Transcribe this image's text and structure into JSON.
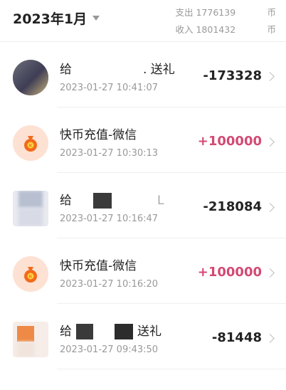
{
  "header": {
    "month": "2023年1月",
    "expense_label": "支出",
    "expense_value": "1776139",
    "income_label": "收入",
    "income_value": "1801432",
    "currency": "币"
  },
  "transactions": [
    {
      "title_prefix": "给",
      "title_suffix": ". 送礼",
      "time": "2023-01-27 10:41:07",
      "amount": "-173328",
      "type": "gift"
    },
    {
      "title": "快币充值-微信",
      "time": "2023-01-27 10:30:13",
      "amount": "+100000",
      "type": "recharge"
    },
    {
      "title_prefix": "给",
      "title_suffix": "L",
      "time": "2023-01-27 10:16:47",
      "amount": "-218084",
      "type": "gift"
    },
    {
      "title": "快币充值-微信",
      "time": "2023-01-27 10:16:20",
      "amount": "+100000",
      "type": "recharge"
    },
    {
      "title_prefix": "给",
      "title_suffix": "送礼",
      "time": "2023-01-27 09:43:50",
      "amount": "-81448",
      "type": "gift"
    }
  ],
  "colors": {
    "positive": "#d24a73",
    "negative": "#222222",
    "icon_bg": "#fde1d3",
    "bag": "#f26a1b"
  }
}
